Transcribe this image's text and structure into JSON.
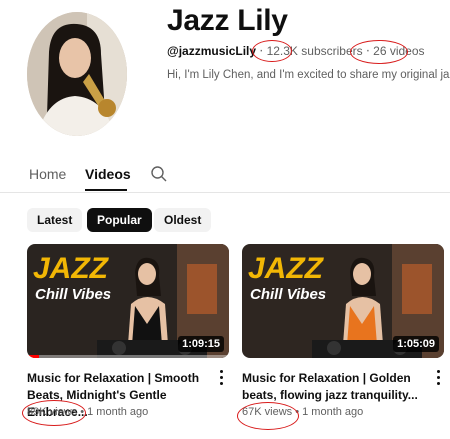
{
  "channel": {
    "name": "Jazz Lily",
    "handle": "@jazzmusicLily",
    "separator": "‧",
    "subscriber_count": "12.3K",
    "subscribers_word": "subscribers",
    "video_count": "26 videos",
    "description": "Hi, I'm Lily Chen, and I'm excited to share my original jazz"
  },
  "tabs": [
    {
      "label": "Home"
    },
    {
      "label": "Videos"
    }
  ],
  "active_tab": "Videos",
  "filter_chips": [
    {
      "label": "Latest"
    },
    {
      "label": "Popular"
    },
    {
      "label": "Oldest"
    }
  ],
  "active_chip": "Popular",
  "videos": [
    {
      "thumb_title": "JAZZ",
      "thumb_subtitle": "Chill Vibes",
      "duration": "1:09:15",
      "watched_fraction": 0.06,
      "title": "Music for Relaxation | Smooth Beats, Midnight's Gentle Embrace...",
      "views": "89K views",
      "dot": "•",
      "age": "1 month ago",
      "outfit_color": "#111111"
    },
    {
      "thumb_title": "JAZZ",
      "thumb_subtitle": "Chill Vibes",
      "duration": "1:05:09",
      "watched_fraction": 0,
      "title": "Music for Relaxation | Golden beats, flowing jazz tranquility...",
      "views": "67K views",
      "dot": "•",
      "age": "1 month ago",
      "outfit_color": "#e8741e"
    }
  ],
  "annotation_color": "#d81b1b",
  "accent_color": "#ff0000"
}
